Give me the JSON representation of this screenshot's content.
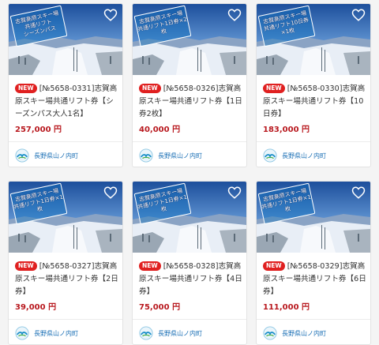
{
  "new_badge": "NEW",
  "products": [
    {
      "title": "[№5658-0331]志賀高原スキー場共通リフト券【シーズンパス大人1名】",
      "price": "257,000 円",
      "sign": "志賀高原スキー場\n共通リフト\nシーズンパス",
      "seller": "長野県山ノ内町"
    },
    {
      "title": "[№5658-0326]志賀高原スキー場共通リフト券【1日券2枚】",
      "price": "40,000 円",
      "sign": "志賀高原スキー場\n共通リフト1日券×2枚",
      "seller": "長野県山ノ内町"
    },
    {
      "title": "[№5658-0330]志賀高原スキー場共通リフト券【10日券】",
      "price": "183,000 円",
      "sign": "志賀高原スキー場\n共通リフト10日券×1枚",
      "seller": "長野県山ノ内町"
    },
    {
      "title": "[№5658-0327]志賀高原スキー場共通リフト券【2日券】",
      "price": "39,000 円",
      "sign": "志賀高原スキー場\n共通リフト1日券×1枚",
      "seller": "長野県山ノ内町"
    },
    {
      "title": "[№5658-0328]志賀高原スキー場共通リフト券【4日券】",
      "price": "75,000 円",
      "sign": "志賀高原スキー場\n共通リフト1日券×1枚",
      "seller": "長野県山ノ内町"
    },
    {
      "title": "[№5658-0329]志賀高原スキー場共通リフト券【6日券】",
      "price": "111,000 円",
      "sign": "志賀高原スキー場\n共通リフト1日券×1枚",
      "seller": "長野県山ノ内町"
    }
  ],
  "icons": {
    "favorite": "heart-outline-icon",
    "seller_logo": "town-emblem-icon"
  }
}
